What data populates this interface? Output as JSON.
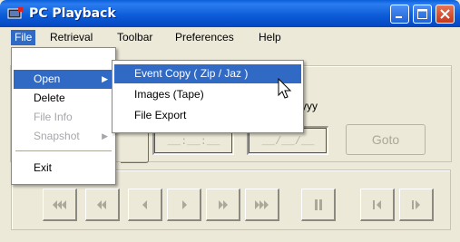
{
  "window": {
    "title": "PC Playback"
  },
  "menubar": {
    "file": "File",
    "retrieval": "Retrieval",
    "toolbar": "Toolbar",
    "preferences": "Preferences",
    "help": "Help"
  },
  "file_menu": {
    "open": "Open",
    "delete": "Delete",
    "file_info": "File Info",
    "snapshot": "Snapshot",
    "exit": "Exit"
  },
  "open_submenu": {
    "event_copy": "Event Copy ( Zip / Jaz )",
    "images_tape": "Images (Tape)",
    "file_export": "File Export"
  },
  "date_panel": {
    "date_format_label": "yyyy",
    "time_field_value": "__:__:__",
    "date_field_value": "__/__/__",
    "goto_label": "Goto"
  },
  "playback_controls": [
    "rewind-fast-icon",
    "rewind-icon",
    "step-back-icon",
    "play-icon",
    "fast-forward-icon",
    "fast-forward-end-icon",
    "pause-icon",
    "frame-back-icon",
    "frame-forward-icon"
  ],
  "colors": {
    "title_bar": "#0b5ad6",
    "menu_highlight": "#316ac5",
    "window_bg": "#ece9d8",
    "close_button": "#c7371a",
    "disabled_text": "#a7a6aa"
  }
}
